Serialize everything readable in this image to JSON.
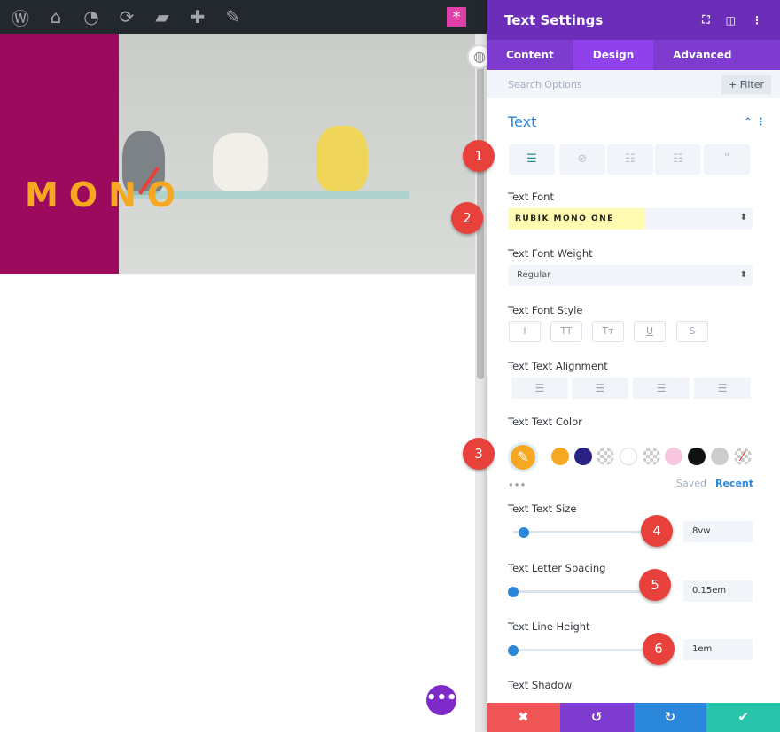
{
  "adminbar": {
    "icons": [
      "wordpress-icon",
      "home-network-icon",
      "dashboard-icon",
      "refresh-icon",
      "comment-icon",
      "plus-icon",
      "pencil-icon"
    ],
    "star": "*"
  },
  "preview": {
    "text": "MONO"
  },
  "panel": {
    "title": "Text Settings",
    "tabs": [
      {
        "label": "Content"
      },
      {
        "label": "Design"
      },
      {
        "label": "Advanced"
      }
    ],
    "search_placeholder": "Search Options",
    "filter_label": "+ Filter",
    "section_title": "Text",
    "text_font": {
      "label": "Text Font",
      "value": "RUBIK MONO ONE"
    },
    "font_weight": {
      "label": "Text Font Weight",
      "value": "Regular"
    },
    "font_style": {
      "label": "Text Font Style",
      "options": [
        "I",
        "TT",
        "Tт",
        "U",
        "S"
      ]
    },
    "alignment": {
      "label": "Text Text Alignment"
    },
    "color": {
      "label": "Text Text Color",
      "swatches": [
        "#f7a823",
        "#2a2185",
        "checker",
        "#ffffff",
        "checker",
        "#f9c6e0",
        "#111111",
        "#cccccc",
        "none"
      ],
      "selected": "#f7a823",
      "saved": "Saved",
      "recent": "Recent",
      "more": "•••"
    },
    "size": {
      "label": "Text Text Size",
      "value": "8vw"
    },
    "letter_spacing": {
      "label": "Text Letter Spacing",
      "value": "0.15em"
    },
    "line_height": {
      "label": "Text Line Height",
      "value": "1em"
    },
    "shadow": {
      "label": "Text Shadow"
    },
    "footer": {
      "cancel": "✖",
      "undo": "↺",
      "redo": "↻",
      "save": "✔"
    }
  },
  "markers": [
    "1",
    "2",
    "3",
    "4",
    "5",
    "6"
  ],
  "colors": {
    "purple": "#6c2eb9",
    "accent": "#2b87da",
    "marker": "#e8403a"
  }
}
